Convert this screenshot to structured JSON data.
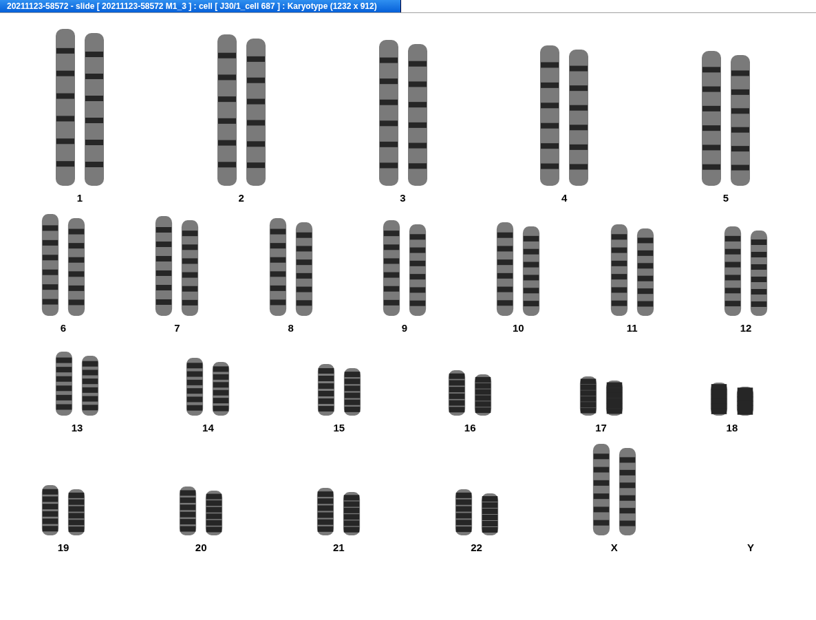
{
  "window": {
    "title": "20211123-58572 - slide [ 20211123-58572 M1_3 ] : cell [ J30/1_cell 687 ] : Karyotype  (1232 x 912)"
  },
  "karyotype": {
    "rows": [
      {
        "groups": [
          {
            "label": "1",
            "kind": "pair"
          },
          {
            "label": "2",
            "kind": "pair"
          },
          {
            "label": "3",
            "kind": "pair"
          },
          {
            "label": "4",
            "kind": "pair"
          },
          {
            "label": "5",
            "kind": "pair"
          }
        ]
      },
      {
        "groups": [
          {
            "label": "6",
            "kind": "pair"
          },
          {
            "label": "7",
            "kind": "pair"
          },
          {
            "label": "8",
            "kind": "pair"
          },
          {
            "label": "9",
            "kind": "pair"
          },
          {
            "label": "10",
            "kind": "pair"
          },
          {
            "label": "11",
            "kind": "pair"
          },
          {
            "label": "12",
            "kind": "pair"
          }
        ]
      },
      {
        "groups": [
          {
            "label": "13",
            "kind": "pair"
          },
          {
            "label": "14",
            "kind": "pair"
          },
          {
            "label": "15",
            "kind": "pair"
          },
          {
            "label": "16",
            "kind": "pair"
          },
          {
            "label": "17",
            "kind": "pair"
          },
          {
            "label": "18",
            "kind": "pair"
          }
        ]
      },
      {
        "groups": [
          {
            "label": "19",
            "kind": "pair"
          },
          {
            "label": "20",
            "kind": "pair"
          },
          {
            "label": "21",
            "kind": "pair"
          },
          {
            "label": "22",
            "kind": "pair"
          },
          {
            "label": "X",
            "kind": "pair"
          },
          {
            "label": "Y",
            "kind": "none"
          }
        ]
      }
    ]
  }
}
